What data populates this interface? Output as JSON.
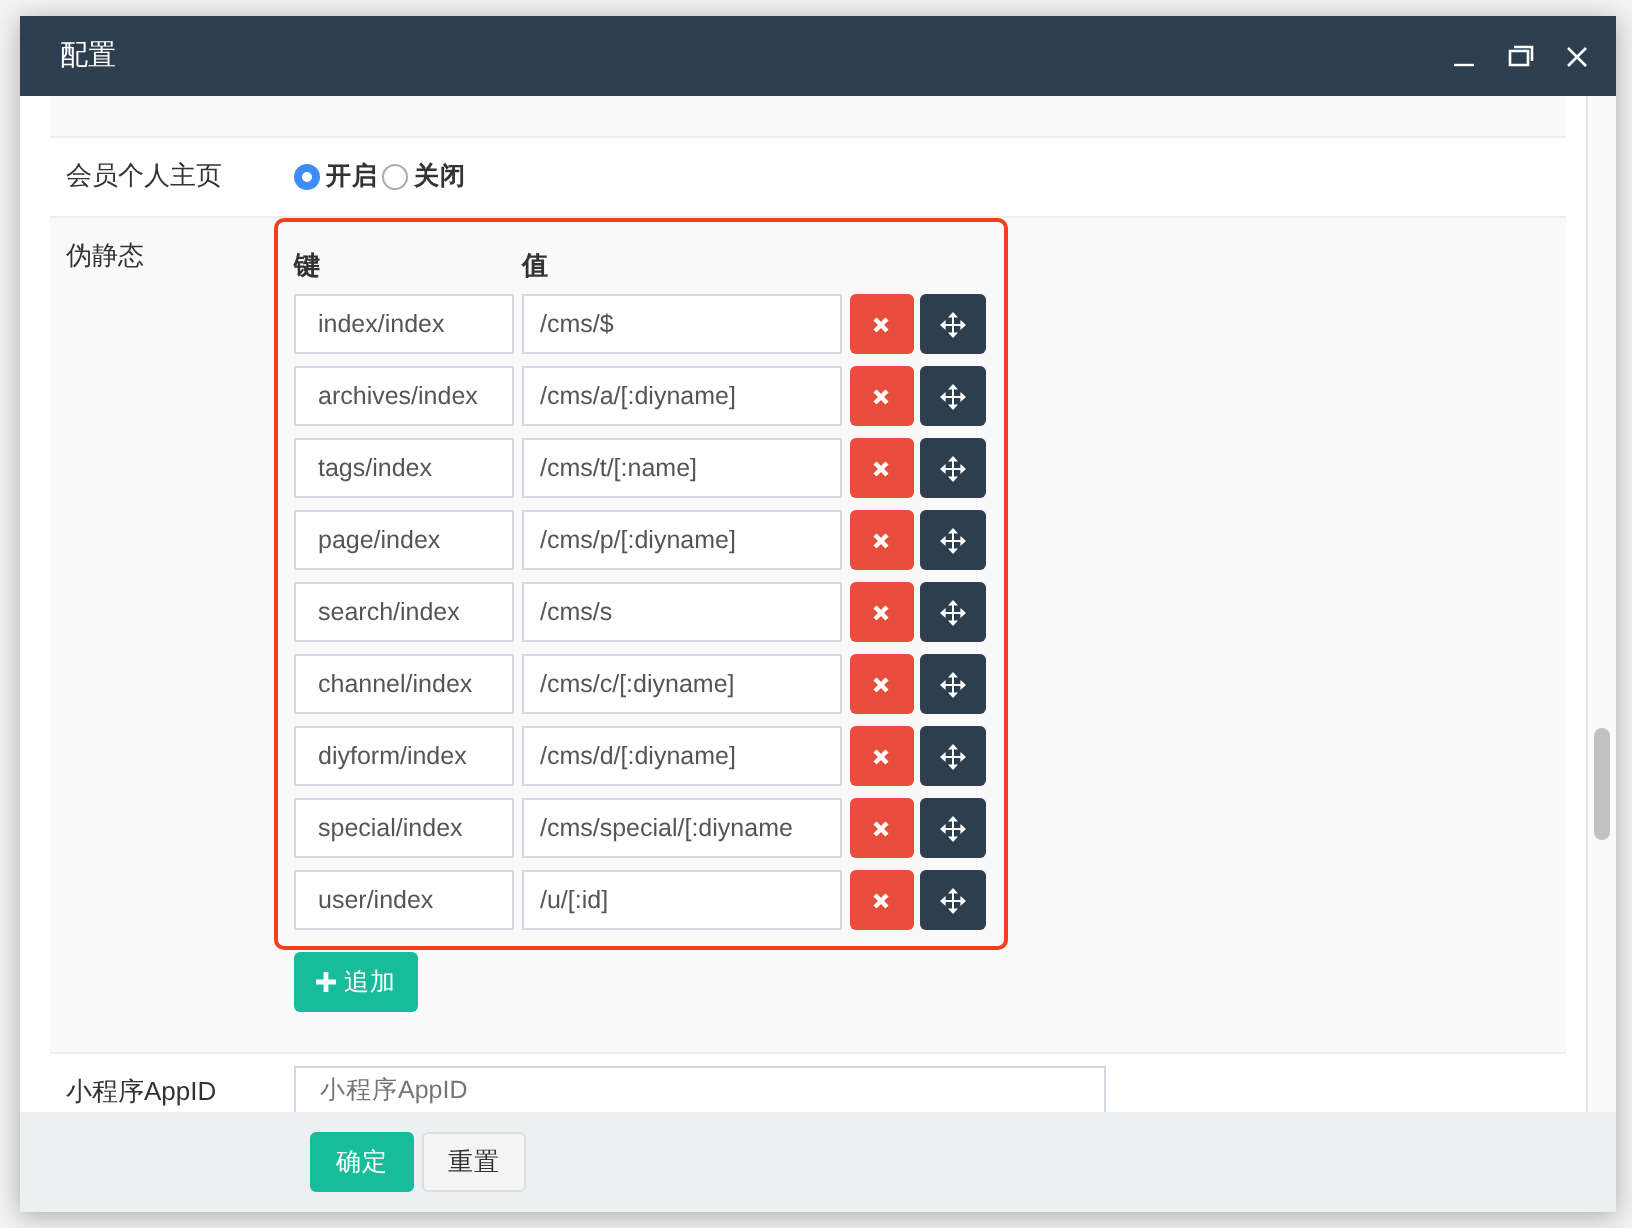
{
  "window": {
    "title": "配置"
  },
  "fields": [
    {
      "kind": "radio",
      "label": "会员个人主页",
      "options": [
        {
          "label": "开启",
          "selected": true
        },
        {
          "label": "关闭",
          "selected": false
        }
      ]
    },
    {
      "kind": "keyvalue",
      "label": "伪静态",
      "highlighted": true,
      "columns": [
        "键",
        "值"
      ],
      "rows": [
        {
          "key": "index/index",
          "value": "/cms/$"
        },
        {
          "key": "archives/index",
          "value": "/cms/a/[:diyname]"
        },
        {
          "key": "tags/index",
          "value": "/cms/t/[:name]"
        },
        {
          "key": "page/index",
          "value": "/cms/p/[:diyname]"
        },
        {
          "key": "search/index",
          "value": "/cms/s"
        },
        {
          "key": "channel/index",
          "value": "/cms/c/[:diyname]"
        },
        {
          "key": "diyform/index",
          "value": "/cms/d/[:diyname]"
        },
        {
          "key": "special/index",
          "value": "/cms/special/[:diyname"
        },
        {
          "key": "user/index",
          "value": "/u/[:id]"
        }
      ],
      "add_button": "追加"
    },
    {
      "kind": "text",
      "label": "小程序AppID",
      "placeholder": "小程序AppID"
    }
  ],
  "buttons": [
    {
      "label": "确定",
      "kind": "primary"
    },
    {
      "label": "重置",
      "kind": "default"
    }
  ]
}
